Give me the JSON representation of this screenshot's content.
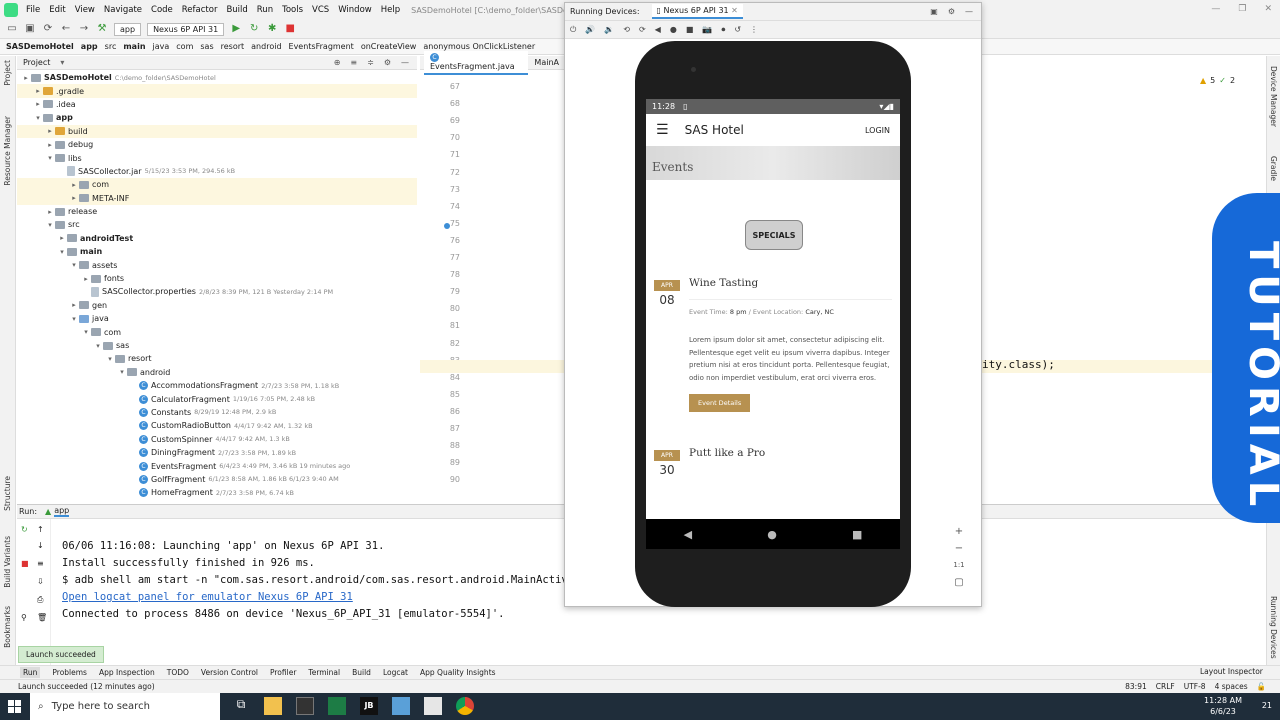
{
  "menu": [
    "File",
    "Edit",
    "View",
    "Navigate",
    "Code",
    "Refactor",
    "Build",
    "Run",
    "Tools",
    "VCS",
    "Window",
    "Help"
  ],
  "window_title": "SASDemoHotel [C:\\demo_folder\\SASDemoHotel] - Ev",
  "toolbar": {
    "run_config": "app",
    "device": "Nexus 6P API 31"
  },
  "breadcrumbs": [
    "SASDemoHotel",
    "app",
    "src",
    "main",
    "java",
    "com",
    "sas",
    "resort",
    "android",
    "EventsFragment",
    "onCreateView",
    "anonymous OnClickListener"
  ],
  "left_strip": [
    "Project",
    "Resource Manager",
    "Structure",
    "Build Variants",
    "Bookmarks"
  ],
  "right_strip": [
    "Device Manager",
    "Gradle",
    "Running Devices"
  ],
  "project": {
    "header": "Project",
    "tree": [
      {
        "depth": 0,
        "label": "SASDemoHotel",
        "meta": "C:\\demo_folder\\SASDemoHotel",
        "icon": "folder-gray",
        "bold": true
      },
      {
        "depth": 1,
        "label": ".gradle",
        "meta": "",
        "icon": "folder-orange",
        "hl": true
      },
      {
        "depth": 1,
        "label": ".idea",
        "meta": "",
        "icon": "folder-gray"
      },
      {
        "depth": 1,
        "label": "app",
        "meta": "",
        "icon": "folder-gray",
        "bold": true,
        "open": true
      },
      {
        "depth": 2,
        "label": "build",
        "meta": "",
        "icon": "folder-orange",
        "hl": true
      },
      {
        "depth": 2,
        "label": "debug",
        "meta": "",
        "icon": "folder-gray"
      },
      {
        "depth": 2,
        "label": "libs",
        "meta": "",
        "icon": "folder-gray",
        "open": true
      },
      {
        "depth": 3,
        "label": "SASCollector.jar",
        "meta": "5/15/23 3:53 PM, 294.56 kB",
        "icon": "jar"
      },
      {
        "depth": 4,
        "label": "com",
        "meta": "",
        "icon": "folder-gray",
        "hl": true
      },
      {
        "depth": 4,
        "label": "META-INF",
        "meta": "",
        "icon": "folder-gray",
        "hl": true
      },
      {
        "depth": 2,
        "label": "release",
        "meta": "",
        "icon": "folder-gray"
      },
      {
        "depth": 2,
        "label": "src",
        "meta": "",
        "icon": "folder-gray",
        "open": true
      },
      {
        "depth": 3,
        "label": "androidTest",
        "meta": "",
        "icon": "folder-gray",
        "bold": true
      },
      {
        "depth": 3,
        "label": "main",
        "meta": "",
        "icon": "folder-gray",
        "bold": true,
        "open": true
      },
      {
        "depth": 4,
        "label": "assets",
        "meta": "",
        "icon": "folder-gray",
        "open": true
      },
      {
        "depth": 5,
        "label": "fonts",
        "meta": "",
        "icon": "folder-gray"
      },
      {
        "depth": 5,
        "label": "SASCollector.properties",
        "meta": "2/8/23 8:39 PM, 121 B Yesterday 2:14 PM",
        "icon": "file"
      },
      {
        "depth": 4,
        "label": "gen",
        "meta": "",
        "icon": "folder-gray"
      },
      {
        "depth": 4,
        "label": "java",
        "meta": "",
        "icon": "folder-blue",
        "open": true
      },
      {
        "depth": 5,
        "label": "com",
        "meta": "",
        "icon": "folder-gray",
        "open": true
      },
      {
        "depth": 6,
        "label": "sas",
        "meta": "",
        "icon": "folder-gray",
        "open": true
      },
      {
        "depth": 7,
        "label": "resort",
        "meta": "",
        "icon": "folder-gray",
        "open": true
      },
      {
        "depth": 8,
        "label": "android",
        "meta": "",
        "icon": "folder-gray",
        "open": true
      },
      {
        "depth": 9,
        "label": "AccommodationsFragment",
        "meta": "2/7/23 3:58 PM, 1.18 kB",
        "icon": "class"
      },
      {
        "depth": 9,
        "label": "CalculatorFragment",
        "meta": "1/19/16 7:05 PM, 2.48 kB",
        "icon": "class"
      },
      {
        "depth": 9,
        "label": "Constants",
        "meta": "8/29/19 12:48 PM, 2.9 kB",
        "icon": "class"
      },
      {
        "depth": 9,
        "label": "CustomRadioButton",
        "meta": "4/4/17 9:42 AM, 1.32 kB",
        "icon": "class"
      },
      {
        "depth": 9,
        "label": "CustomSpinner",
        "meta": "4/4/17 9:42 AM, 1.3 kB",
        "icon": "class"
      },
      {
        "depth": 9,
        "label": "DiningFragment",
        "meta": "2/7/23 3:58 PM, 1.89 kB",
        "icon": "class"
      },
      {
        "depth": 9,
        "label": "EventsFragment",
        "meta": "6/4/23 4:49 PM, 3.46 kB 19 minutes ago",
        "icon": "class"
      },
      {
        "depth": 9,
        "label": "GolfFragment",
        "meta": "6/1/23 8:58 AM, 1.86 kB 6/1/23 9:40 AM",
        "icon": "class"
      },
      {
        "depth": 9,
        "label": "HomeFragment",
        "meta": "2/7/23 3:58 PM, 6.74 kB",
        "icon": "class"
      }
    ]
  },
  "editor": {
    "tabs": [
      "EventsFragment.java",
      "MainA"
    ],
    "line_numbers": [
      "67",
      "68",
      "69",
      "70",
      "71",
      "72",
      "73",
      "74",
      "75",
      "76",
      "77",
      "78",
      "79",
      "80",
      "81",
      "82",
      "83",
      "84",
      "85",
      "86",
      "87",
      "88",
      "89",
      "90"
    ],
    "code_fragment": "ity.class);",
    "warnings": "5",
    "warnings2": "2"
  },
  "run": {
    "label": "Run:",
    "tab": "app",
    "lines": [
      "06/06 11:16:08: Launching 'app' on Nexus 6P API 31.",
      "Install successfully finished in 926 ms.",
      "$ adb shell am start -n \"com.sas.resort.android/com.sas.resort.android.MainActivity\"",
      "Open logcat panel for emulator Nexus 6P API 31",
      "Connected to process 8486 on device 'Nexus_6P_API_31 [emulator-5554]'."
    ]
  },
  "toast": "Launch succeeded",
  "bottom_tabs": [
    "Run",
    "Problems",
    "App Inspection",
    "TODO",
    "Version Control",
    "Profiler",
    "Terminal",
    "Build",
    "Logcat",
    "App Quality Insights"
  ],
  "layout_inspector": "Layout Inspector",
  "status": {
    "message": "Launch succeeded (12 minutes ago)",
    "position": "83:91",
    "line_sep": "CRLF",
    "encoding": "UTF-8",
    "indent": "4 spaces"
  },
  "running_devices": {
    "title": "Running Devices:",
    "tab": "Nexus 6P API 31",
    "zoom": "1:1"
  },
  "phone": {
    "time": "11:28",
    "app_title": "SAS Hotel",
    "login": "LOGIN",
    "hero_title": "Events",
    "specials": "SPECIALS",
    "event1": {
      "month": "APR",
      "day": "08",
      "title": "Wine Tasting",
      "time_label": "Event Time:",
      "time": "8 pm",
      "location_label": " / Event Location:",
      "location": "Cary, NC",
      "body": "Lorem ipsum dolor sit amet, consectetur adipiscing elit. Pellentesque eget velit eu ipsum viverra dapibus. Integer pretium nisi at eros tincidunt porta. Pellentesque feugiat, odio non imperdiet vestibulum, erat orci viverra eros.",
      "button": "Event Details"
    },
    "event2": {
      "month": "APR",
      "day": "30",
      "title": "Putt like a Pro"
    }
  },
  "tutorial_banner": "TUTORIAL",
  "taskbar": {
    "search_placeholder": "Type here to search",
    "time": "11:28 AM",
    "date": "6/6/23",
    "notifications": "21"
  },
  "colors": {
    "accent": "#3d8ed6",
    "gold": "#b79150",
    "banner": "#1669d8"
  }
}
